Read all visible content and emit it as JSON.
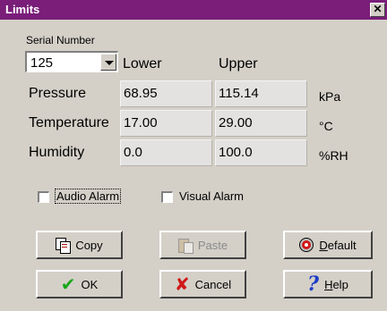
{
  "window": {
    "title": "Limits",
    "close_glyph": "✕"
  },
  "serial": {
    "label": "Serial Number",
    "value": "125"
  },
  "columns": {
    "lower": "Lower",
    "upper": "Upper"
  },
  "rows": [
    {
      "label": "Pressure",
      "lower": "68.95",
      "upper": "115.14",
      "unit": "kPa"
    },
    {
      "label": "Temperature",
      "lower": "17.00",
      "upper": "29.00",
      "unit": "°C"
    },
    {
      "label": "Humidity",
      "lower": "0.0",
      "upper": "100.0",
      "unit": "%RH"
    }
  ],
  "alarms": {
    "audio": {
      "label": "Audio Alarm",
      "checked": false
    },
    "visual": {
      "label": "Visual Alarm",
      "checked": false
    }
  },
  "buttons": {
    "copy": {
      "label": "Copy",
      "icon": "copy-icon"
    },
    "paste": {
      "label": "Paste",
      "icon": "paste-icon",
      "enabled": false
    },
    "default": {
      "mnemonic": "D",
      "rest": "efault",
      "icon": "default-icon"
    },
    "ok": {
      "label": "OK",
      "icon": "checkmark-icon"
    },
    "cancel": {
      "label": "Cancel",
      "icon": "x-icon"
    },
    "help": {
      "mnemonic": "H",
      "rest": "elp",
      "icon": "question-icon"
    }
  },
  "colors": {
    "titlebar": "#7a1e79",
    "dialog": "#d4d0c8",
    "cell": "#e3e2e0"
  }
}
